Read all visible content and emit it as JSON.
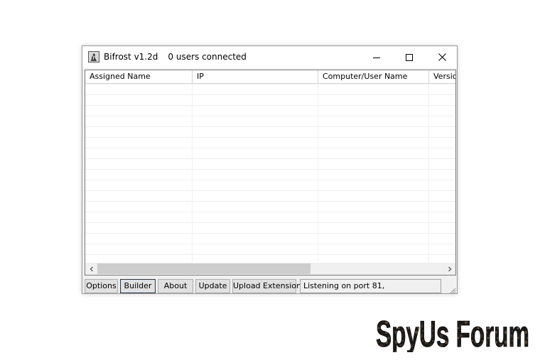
{
  "window": {
    "title": "Bifrost v1.2d",
    "status": "0 users connected"
  },
  "table": {
    "columns": [
      "Assigned Name",
      "IP",
      "Computer/User Name",
      "Version"
    ],
    "rows": []
  },
  "buttons": {
    "options": "Options",
    "builder": "Builder",
    "about": "About",
    "update": "Update",
    "upload_extension": "Upload Extension"
  },
  "statusbar": {
    "text": "Listening on port 81,"
  },
  "watermark": {
    "text": "SpyUs Forum"
  },
  "icons": [
    "bifrost-app-icon",
    "minimize-icon",
    "maximize-icon",
    "close-icon",
    "scroll-left-arrow-icon",
    "scroll-right-arrow-icon",
    "resize-grip-icon"
  ]
}
